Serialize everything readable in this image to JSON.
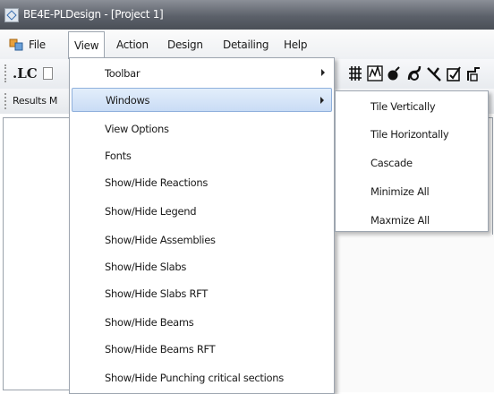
{
  "window": {
    "title": "BE4E-PLDesign - [Project 1]"
  },
  "menubar": {
    "items": [
      "File",
      "View",
      "Action",
      "Design",
      "Detailing",
      "Help"
    ]
  },
  "toolbar": {
    "lc_label": ".LC"
  },
  "results_label": "Results M",
  "view_menu": {
    "items": [
      {
        "label": "Toolbar",
        "submenu": true
      },
      {
        "label": "Windows",
        "submenu": true,
        "highlighted": true
      },
      {
        "label": "View Options"
      },
      {
        "label": "Fonts"
      },
      {
        "label": "Show/Hide Reactions"
      },
      {
        "label": "Show/Hide Legend"
      },
      {
        "label": "Show/Hide Assemblies"
      },
      {
        "label": "Show/Hide Slabs"
      },
      {
        "label": "Show/Hide Slabs RFT"
      },
      {
        "label": "Show/Hide Beams"
      },
      {
        "label": "Show/Hide Beams RFT"
      },
      {
        "label": "Show/Hide Punching critical sections"
      }
    ]
  },
  "windows_submenu": {
    "items": [
      "Tile Vertically",
      "Tile Horizontally",
      "Cascade",
      "Minimize All",
      "Maxmize All"
    ]
  },
  "icons": [
    "grid-icon",
    "graph-icon",
    "bomb-icon",
    "bend-icon",
    "angle-icon",
    "check-edit-icon",
    "bracket-icon"
  ],
  "colors": {
    "highlight": "#c9dcf5",
    "titlebar": "#5c616a"
  }
}
